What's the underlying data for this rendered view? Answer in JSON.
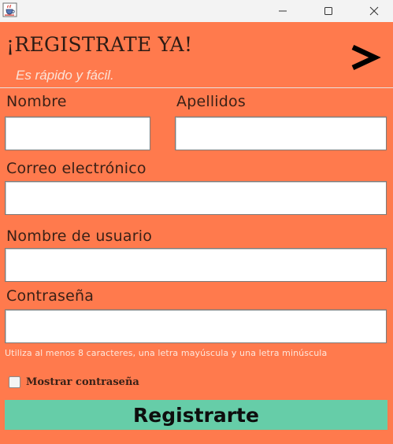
{
  "window": {
    "app_icon": "java-coffee-icon",
    "controls": [
      "minimize-icon",
      "maximize-icon",
      "close-icon"
    ]
  },
  "header": {
    "title": "¡REGISTRATE YA!",
    "subtitle": "Es rápido y fácil.",
    "next_symbol": ">"
  },
  "form": {
    "first_name_label": "Nombre",
    "last_name_label": "Apellidos",
    "email_label": "Correo electrónico",
    "username_label": "Nombre de usuario",
    "password_label": "Contraseña",
    "first_name_value": "",
    "last_name_value": "",
    "email_value": "",
    "username_value": "",
    "password_value": "",
    "password_hint": "Utiliza al menos 8 caracteres, una letra mayúscula y una letra minúscula",
    "show_password_label": "Mostrar contraseña",
    "show_password_checked": false,
    "submit_label": "Registrarte"
  },
  "colors": {
    "background": "#ff7a4d",
    "submit_button": "#66cda8",
    "titlebar": "#f3f3f3"
  }
}
